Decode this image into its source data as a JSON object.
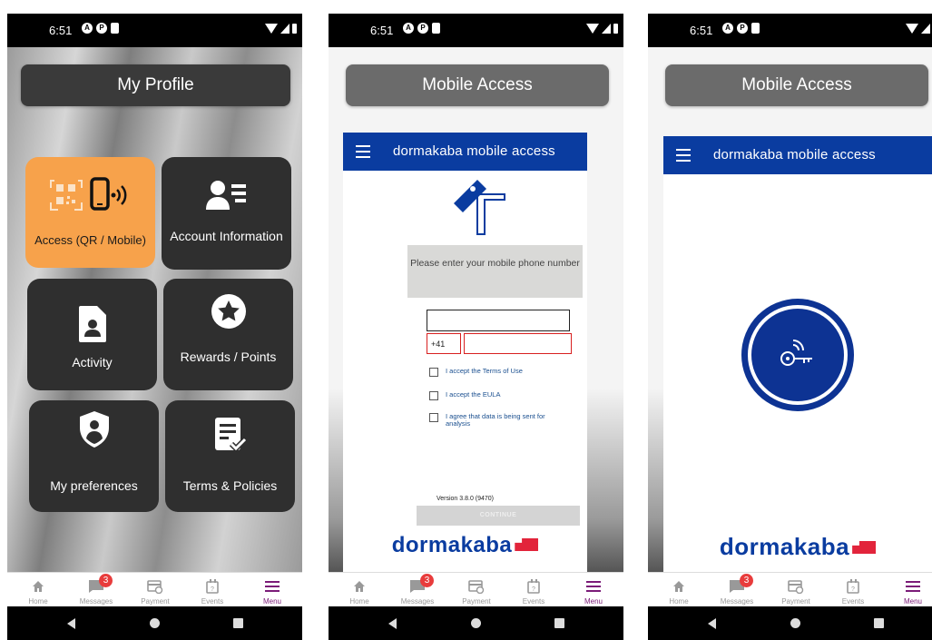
{
  "status": {
    "time": "6:51"
  },
  "screen1": {
    "title": "My Profile",
    "tiles": [
      {
        "label": "Access  (QR / Mobile)",
        "icon": "qr-mobile-icon"
      },
      {
        "label": "Account Information",
        "icon": "account-card-icon"
      },
      {
        "label": "Activity",
        "icon": "document-person-icon"
      },
      {
        "label": "Rewards / Points",
        "icon": "star-circle-icon"
      },
      {
        "label": "My preferences",
        "icon": "shield-person-icon"
      },
      {
        "label": "Terms & Policies",
        "icon": "document-check-icon"
      }
    ]
  },
  "screen2": {
    "title": "Mobile Access",
    "web_title": "dormakaba mobile access",
    "prompt": "Please enter your mobile phone number",
    "country_code": "+41",
    "checkboxes": [
      "I accept the Terms of Use",
      "I accept the EULA",
      "I agree that data is being sent for analysis"
    ],
    "version": "Version 3.8.0 (9470)",
    "continue_label": "CONTINUE",
    "brand": "dormakaba"
  },
  "screen3": {
    "title": "Mobile Access",
    "web_title": "dormakaba mobile access",
    "brand": "dormakaba"
  },
  "nav": {
    "items": [
      {
        "label": "Home",
        "icon": "home-icon"
      },
      {
        "label": "Messages",
        "icon": "chat-icon",
        "badge": "3"
      },
      {
        "label": "Payment",
        "icon": "payment-icon"
      },
      {
        "label": "Events",
        "icon": "calendar-icon"
      },
      {
        "label": "Menu",
        "icon": "menu-icon"
      }
    ]
  },
  "colors": {
    "accent_orange": "#f7a24b",
    "brand_blue": "#0a3ca0",
    "active_nav": "#7b1b78",
    "badge_red": "#e83c3c"
  }
}
